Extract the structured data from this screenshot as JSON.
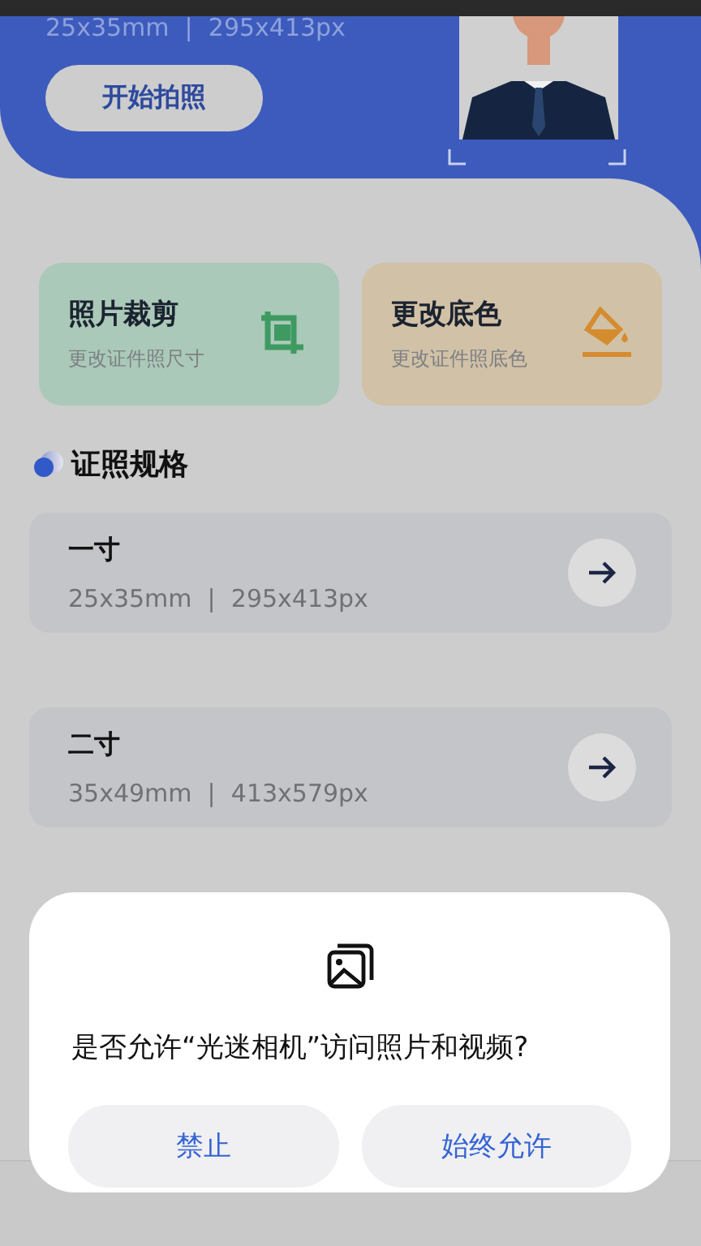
{
  "header": {
    "size_text": "25x35mm  |  295x413px",
    "button": "开始拍照"
  },
  "tools": [
    {
      "kind": "crop",
      "title": "照片裁剪",
      "subtitle": "更改证件照尺寸"
    },
    {
      "kind": "fill",
      "title": "更改底色",
      "subtitle": "更改证件照底色"
    }
  ],
  "section_title": "证照规格",
  "specs": [
    {
      "name": "一寸",
      "size": "25x35mm  |  295x413px"
    },
    {
      "name": "二寸",
      "size": "35x49mm  |  413x579px"
    }
  ],
  "dialog": {
    "message": "是否允许“光迷相机”访问照片和视频?",
    "buttons": [
      "禁止",
      "始终允许"
    ]
  }
}
